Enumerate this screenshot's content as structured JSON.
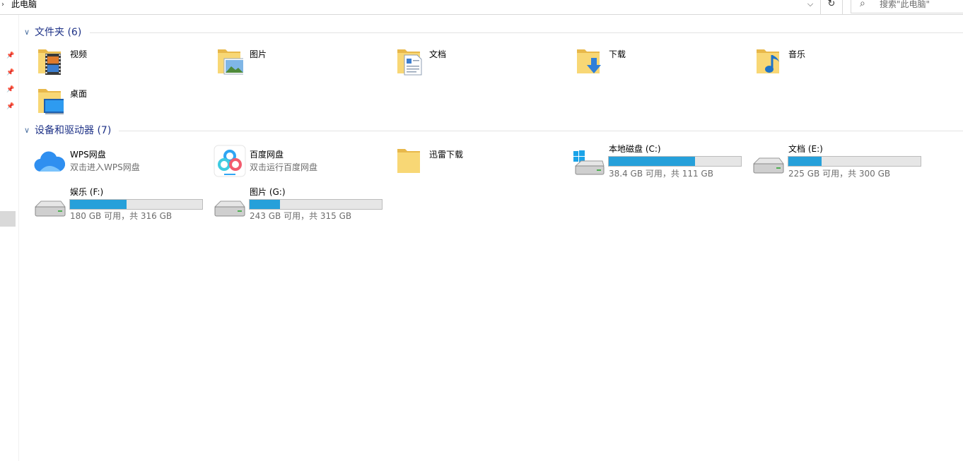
{
  "address": {
    "path": "此电脑",
    "search_placeholder": "搜索\"此电脑\""
  },
  "sections": {
    "folders": {
      "title": "文件夹 (6)"
    },
    "devices": {
      "title": "设备和驱动器 (7)"
    }
  },
  "folders": [
    {
      "name": "视频",
      "icon": "video-folder-icon"
    },
    {
      "name": "图片",
      "icon": "pictures-folder-icon"
    },
    {
      "name": "文档",
      "icon": "documents-folder-icon"
    },
    {
      "name": "下载",
      "icon": "downloads-folder-icon"
    },
    {
      "name": "音乐",
      "icon": "music-folder-icon"
    },
    {
      "name": "桌面",
      "icon": "desktop-folder-icon"
    }
  ],
  "devices": [
    {
      "name": "WPS网盘",
      "subtitle": "双击进入WPS网盘",
      "icon": "wps-cloud-icon"
    },
    {
      "name": "百度网盘",
      "subtitle": "双击运行百度网盘",
      "icon": "baidu-netdisk-icon"
    },
    {
      "name": "迅雷下载",
      "icon": "folder-icon"
    },
    {
      "name": "本地磁盘 (C:)",
      "free_text": "38.4 GB 可用，共 111 GB",
      "used_fraction": 0.654,
      "icon": "windows-drive-icon"
    },
    {
      "name": "文档 (E:)",
      "free_text": "225 GB 可用，共 300 GB",
      "used_fraction": 0.25,
      "icon": "hard-drive-icon"
    },
    {
      "name": "娱乐 (F:)",
      "free_text": "180 GB 可用，共 316 GB",
      "used_fraction": 0.43,
      "icon": "hard-drive-icon"
    },
    {
      "name": "图片 (G:)",
      "free_text": "243 GB 可用，共 315 GB",
      "used_fraction": 0.229,
      "icon": "hard-drive-icon"
    }
  ],
  "colors": {
    "accent": "#26a0da",
    "section_title": "#1e3287",
    "folder": "#f8d775"
  }
}
